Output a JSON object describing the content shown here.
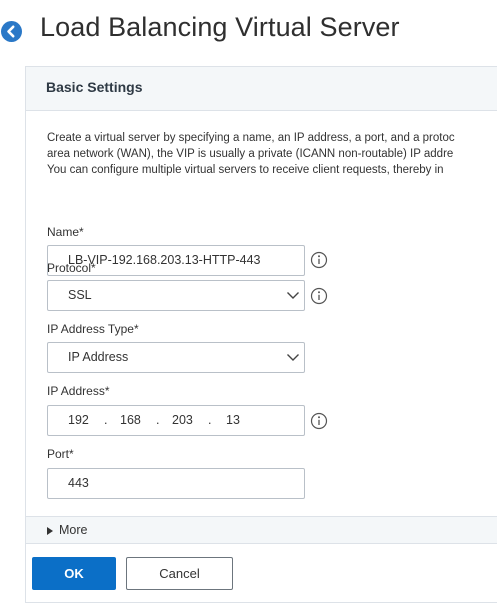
{
  "header": {
    "title": "Load Balancing Virtual Server",
    "back_icon": "arrow-left-circle-icon",
    "accent_color": "#2a78c7"
  },
  "section": {
    "title": "Basic Settings",
    "description": [
      "Create a virtual server by specifying a name, an IP address, a port, and a protoc",
      "area network (WAN), the VIP is usually a private (ICANN non-routable) IP addre",
      "You can configure multiple virtual servers to receive client requests, thereby in"
    ]
  },
  "fields": {
    "name": {
      "label": "Name*",
      "value": "LB-VIP-192.168.203.13-HTTP-443"
    },
    "protocol": {
      "label": "Protocol*",
      "value": "SSL"
    },
    "ip_address_type": {
      "label": "IP Address Type*",
      "value": "IP Address"
    },
    "ip_address": {
      "label": "IP Address*",
      "octets": [
        "192",
        "168",
        "203",
        "13"
      ],
      "separator": "."
    },
    "port": {
      "label": "Port*",
      "value": "443"
    }
  },
  "more": {
    "label": "More"
  },
  "buttons": {
    "ok": "OK",
    "cancel": "Cancel",
    "primary_color": "#0b6fc7"
  }
}
